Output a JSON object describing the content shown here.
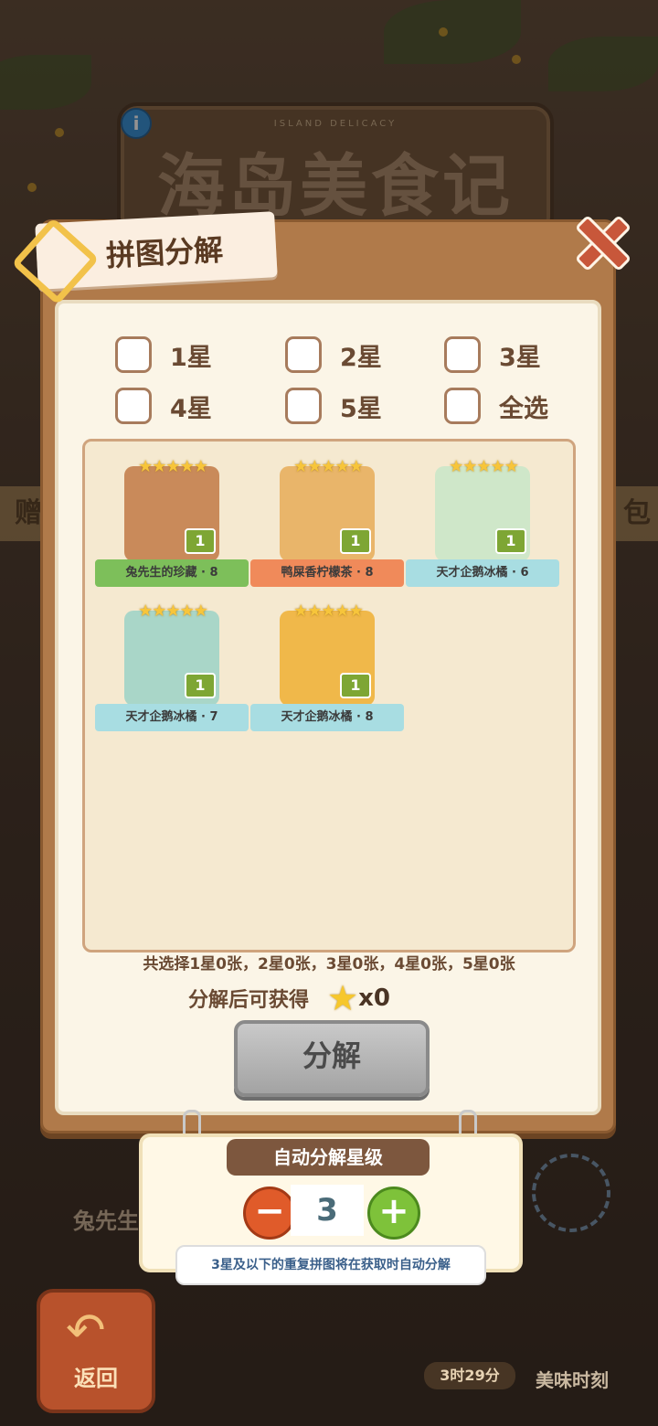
{
  "game": {
    "title_sub": "ISLAND DELICACY",
    "title_main": "海岛美食记",
    "info_icon": "i"
  },
  "side": {
    "left_text": "赠",
    "right_text": "包"
  },
  "dialog": {
    "title": "拼图分解",
    "filters": [
      {
        "label": "1星"
      },
      {
        "label": "2星"
      },
      {
        "label": "3星"
      },
      {
        "label": "4星"
      },
      {
        "label": "5星"
      },
      {
        "label": "全选"
      }
    ],
    "cards": [
      {
        "name": "兔先生的珍藏 · 8",
        "count": "1",
        "stars": "★★★★★",
        "banner_color": "#7dbf5a",
        "pic_color": "#c98a5a"
      },
      {
        "name": "鸭屎香柠檬茶 · 8",
        "count": "1",
        "stars": "★★★★★",
        "banner_color": "#f08a5a",
        "pic_color": "#e9b56a"
      },
      {
        "name": "天才企鹅冰橘 · 6",
        "count": "1",
        "stars": "★★★★★",
        "banner_color": "#a8dde2",
        "pic_color": "#cfe7c9"
      },
      {
        "name": "天才企鹅冰橘 · 7",
        "count": "1",
        "stars": "★★★★★",
        "banner_color": "#a8dde2",
        "pic_color": "#a9d6c8"
      },
      {
        "name": "天才企鹅冰橘 · 8",
        "count": "1",
        "stars": "★★★★★",
        "banner_color": "#a8dde2",
        "pic_color": "#f0b84a"
      }
    ],
    "summary": "共选择1星0张，2星0张，3星0张，4星0张，5星0张",
    "gain_label": "分解后可获得",
    "gain_count": "x0",
    "decompose_button": "分解"
  },
  "auto": {
    "title": "自动分解星级",
    "minus": "−",
    "plus": "+",
    "level": "3",
    "tooltip": "3星及以下的重复拼图将在获取时自动分解"
  },
  "bottom": {
    "back_label": "返回",
    "timer": "3时29分",
    "meiwei": "美味时刻",
    "bg_card_text": "兔先生"
  }
}
